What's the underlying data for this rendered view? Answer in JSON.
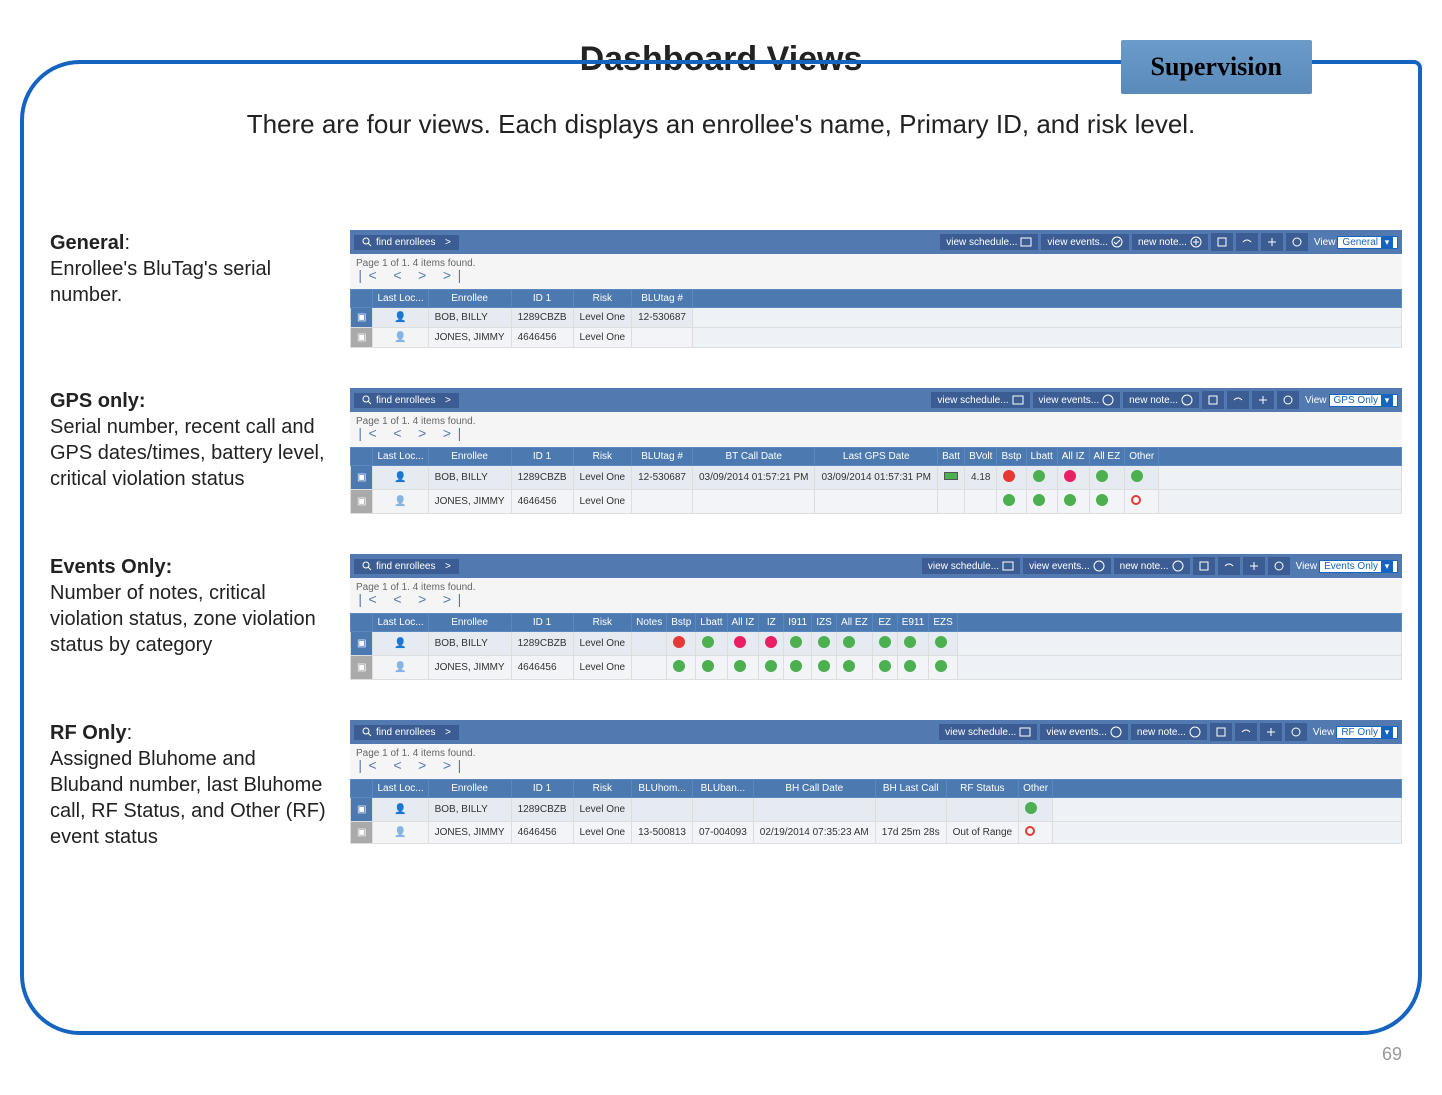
{
  "badge": "Supervision",
  "title": "Dashboard Views",
  "subtitle": "There are four views. Each displays an enrollee's name, Primary ID, and risk level.",
  "page_num": "69",
  "toolbar": {
    "find": "find enrollees",
    "schedule": "view schedule...",
    "events": "view events...",
    "note": "new note...",
    "view_label": "View"
  },
  "page_info": "Page 1 of 1. 4 items found.",
  "sections": {
    "general": {
      "label": "General",
      "desc": "Enrollee's BluTag's serial number.",
      "view_sel": "General",
      "headers": [
        "",
        "Last Loc...",
        "Enrollee",
        "ID 1",
        "Risk",
        "BLUtag #"
      ],
      "rows": [
        [
          "BOB, BILLY",
          "1289CBZB",
          "Level One",
          "12-530687"
        ],
        [
          "JONES, JIMMY",
          "4646456",
          "Level One",
          ""
        ]
      ]
    },
    "gps": {
      "label": "GPS only:",
      "desc": "Serial number, recent call and GPS dates/times, battery level, critical violation status",
      "view_sel": "GPS Only",
      "headers": [
        "",
        "Last Loc...",
        "Enrollee",
        "ID 1",
        "Risk",
        "BLUtag #",
        "BT Call Date",
        "Last GPS Date",
        "Batt",
        "BVolt",
        "Bstp",
        "Lbatt",
        "All IZ",
        "All EZ",
        "Other"
      ],
      "rows": [
        [
          "BOB, BILLY",
          "1289CBZB",
          "Level One",
          "12-530687",
          "03/09/2014 01:57:21 PM",
          "03/09/2014 01:57:31 PM",
          "batt",
          "4.18",
          "r",
          "g",
          "p",
          "g",
          "g"
        ],
        [
          "JONES, JIMMY",
          "4646456",
          "Level One",
          "",
          "",
          "",
          "",
          "",
          "g",
          "g",
          "g",
          "g",
          "o"
        ]
      ]
    },
    "events": {
      "label": "Events Only:",
      "desc": "Number of notes, critical violation status, zone violation status by category",
      "view_sel": "Events Only",
      "headers": [
        "",
        "Last Loc...",
        "Enrollee",
        "ID 1",
        "Risk",
        "Notes",
        "Bstp",
        "Lbatt",
        "All IZ",
        "IZ",
        "I911",
        "IZS",
        "All EZ",
        "EZ",
        "E911",
        "EZS"
      ],
      "rows": [
        [
          "BOB, BILLY",
          "1289CBZB",
          "Level One",
          "",
          "r",
          "g",
          "p",
          "p",
          "g",
          "g",
          "g",
          "g",
          "g",
          "g"
        ],
        [
          "JONES, JIMMY",
          "4646456",
          "Level One",
          "",
          "g",
          "g",
          "g",
          "g",
          "g",
          "g",
          "g",
          "g",
          "g",
          "g"
        ]
      ]
    },
    "rf": {
      "label": "RF Only",
      "desc": "Assigned Bluhome and Bluband number, last Bluhome call, RF Status, and Other (RF) event status",
      "view_sel": "RF Only",
      "headers": [
        "",
        "Last Loc...",
        "Enrollee",
        "ID 1",
        "Risk",
        "BLUhom...",
        "BLUban...",
        "BH Call Date",
        "BH Last Call",
        "RF Status",
        "Other"
      ],
      "rows": [
        [
          "BOB, BILLY",
          "1289CBZB",
          "Level One",
          "",
          "",
          "",
          "",
          "",
          "g"
        ],
        [
          "JONES, JIMMY",
          "4646456",
          "Level One",
          "13-500813",
          "07-004093",
          "02/19/2014 07:35:23 AM",
          "17d 25m 28s",
          "Out of Range",
          "o"
        ]
      ]
    }
  }
}
